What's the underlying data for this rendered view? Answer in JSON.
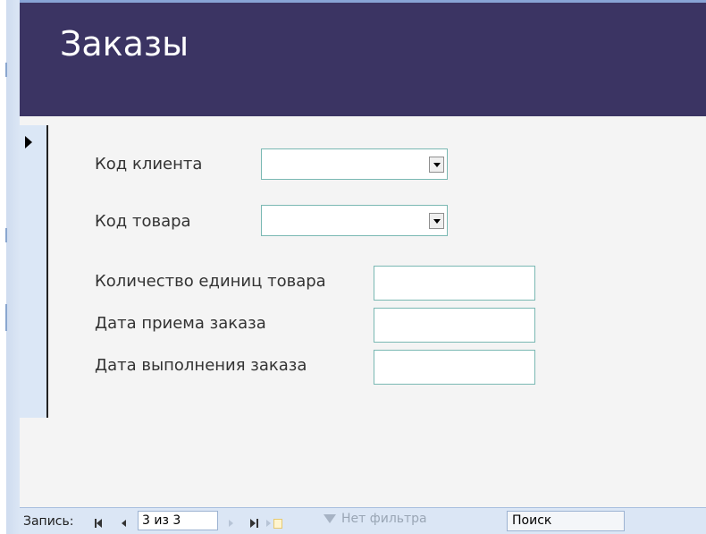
{
  "form": {
    "title": "Заказы"
  },
  "fields": {
    "client_code": {
      "label": "Код клиента",
      "value": ""
    },
    "product_code": {
      "label": "Код товара",
      "value": ""
    },
    "quantity": {
      "label": "Количество единиц товара",
      "value": ""
    },
    "order_date": {
      "label": "Дата приема заказа",
      "value": ""
    },
    "completion_date": {
      "label": "Дата выполнения заказа",
      "value": ""
    }
  },
  "navigation": {
    "record_label": "Запись:",
    "record_position": "3 из 3",
    "filter_label": "Нет фильтра",
    "search_value": "Поиск"
  },
  "colors": {
    "header_bg": "#3b3463",
    "field_border": "#7ab8b3",
    "nav_bg": "#dbe6f5"
  }
}
